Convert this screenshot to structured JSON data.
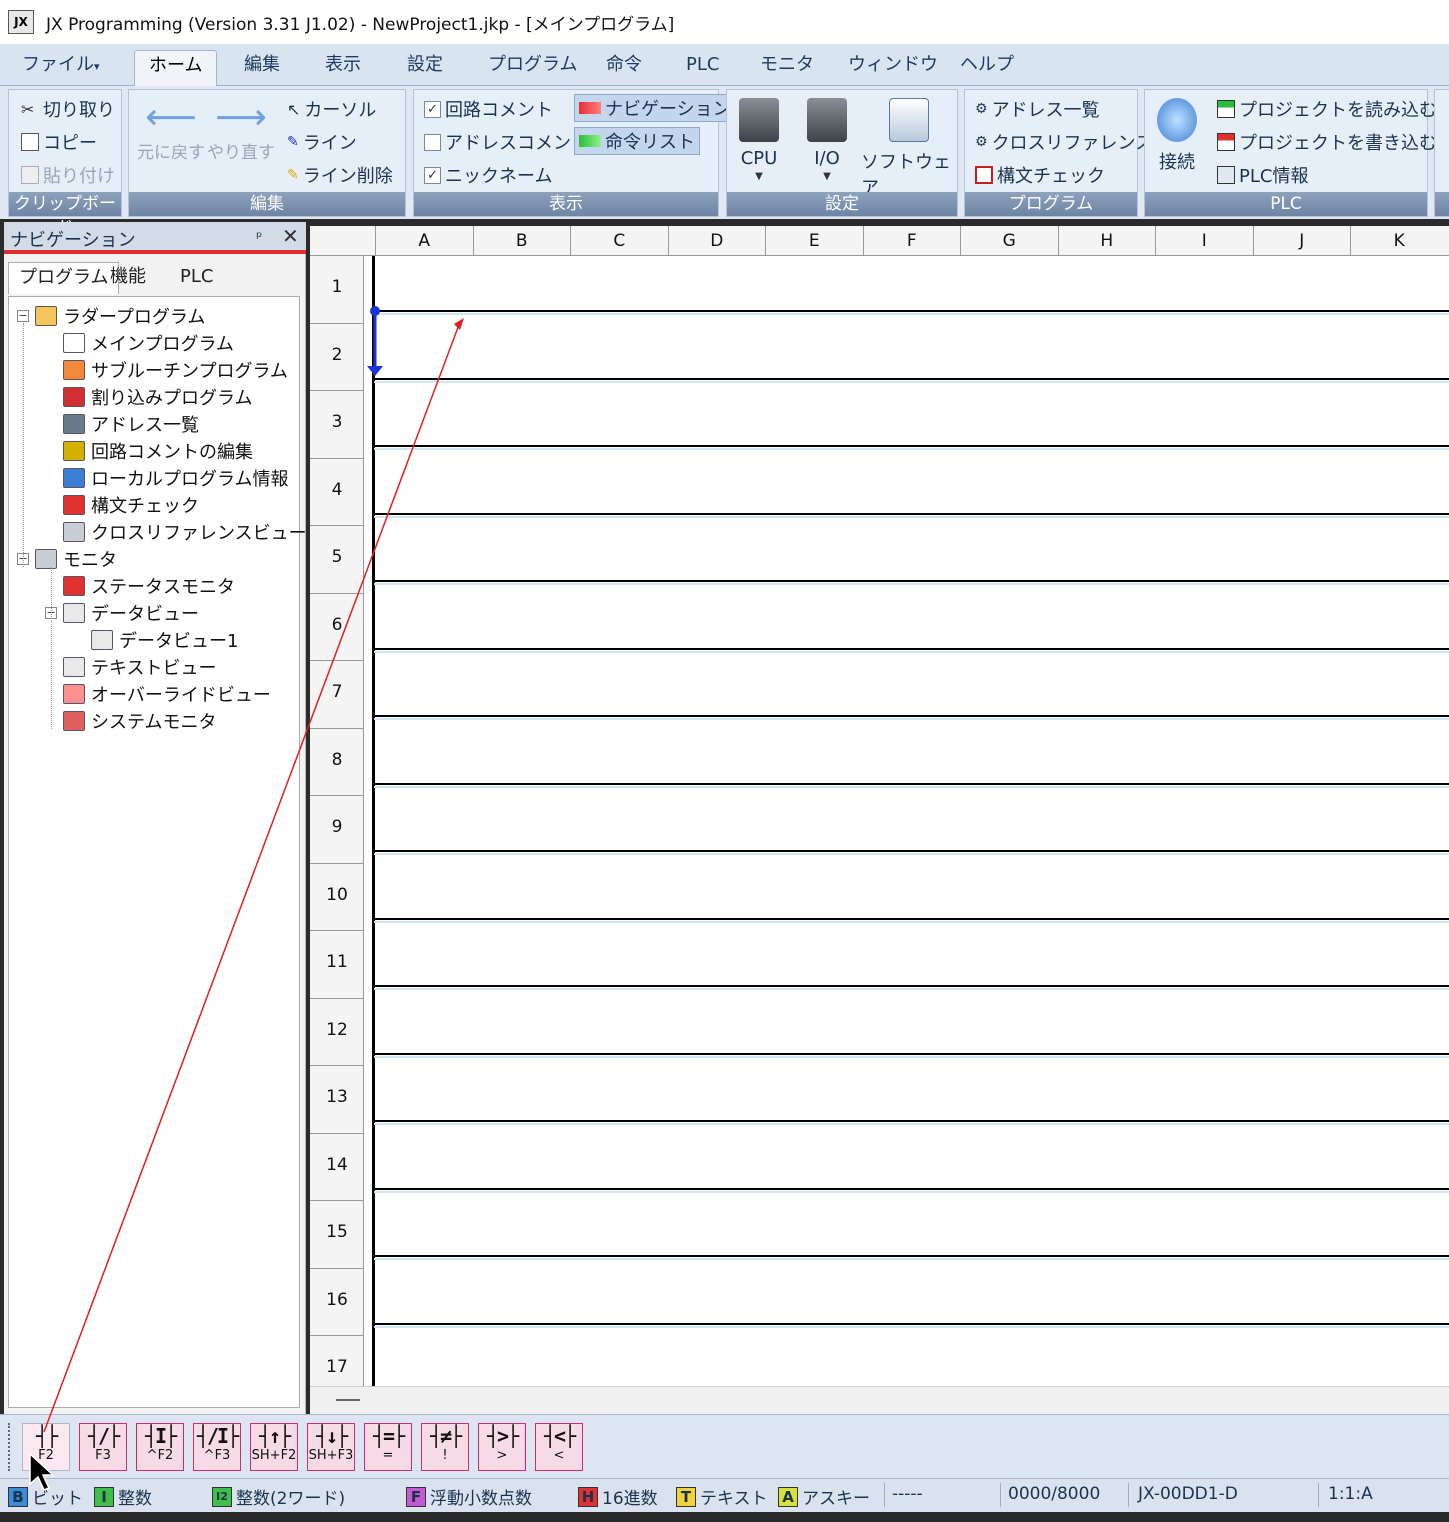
{
  "window": {
    "title": "JX Programming (Version 3.31 J1.02) - NewProject1.jkp - [メインプログラム]",
    "app_icon_text": "JX"
  },
  "menu": {
    "tabs": [
      "ファイル",
      "ホーム",
      "編集",
      "表示",
      "設定",
      "プログラム",
      "命令",
      "PLC",
      "モニタ",
      "ウィンドウ",
      "ヘルプ"
    ],
    "active": "ホーム"
  },
  "ribbon": {
    "clipboard": {
      "label": "クリップボード",
      "cut": "切り取り",
      "copy": "コピー",
      "paste": "貼り付け"
    },
    "edit": {
      "label": "編集",
      "undo": "元に戻す",
      "redo": "やり直す",
      "cursor": "カーソル",
      "line": "ライン",
      "line_delete": "ライン削除"
    },
    "view": {
      "label": "表示",
      "circuit_comment": "回路コメント",
      "circuit_comment_checked": true,
      "address_comment": "アドレスコメント",
      "address_comment_checked": false,
      "nickname": "ニックネーム",
      "nickname_checked": true,
      "navigation": "ナビゲーション",
      "instruction_list": "命令リスト"
    },
    "settings": {
      "label": "設定",
      "cpu": "CPU",
      "io": "I/O",
      "software": "ソフトウェア"
    },
    "program": {
      "label": "プログラム",
      "address_list": "アドレス一覧",
      "cross_reference": "クロスリファレンス",
      "syntax_check": "構文チェック"
    },
    "plc": {
      "label": "PLC",
      "connect": "接続",
      "read_project": "プロジェクトを読み込む",
      "write_project": "プロジェクトを書き込む",
      "plc_info": "PLC情報"
    }
  },
  "navigation": {
    "title": "ナビゲーション",
    "pin": "ᵖ",
    "close": "✕",
    "tabs": [
      "プログラム",
      "機能",
      "PLC"
    ],
    "active_tab": "プログラム",
    "tree": [
      {
        "label": "ラダープログラム",
        "level": 0,
        "expander": "−",
        "icon": "folder-open-icon"
      },
      {
        "label": "メインプログラム",
        "level": 1,
        "icon": "main-program-icon"
      },
      {
        "label": "サブルーチンプログラム",
        "level": 1,
        "icon": "subroutine-icon"
      },
      {
        "label": "割り込みプログラム",
        "level": 1,
        "icon": "interrupt-icon"
      },
      {
        "label": "アドレス一覧",
        "level": 1,
        "icon": "address-list-icon"
      },
      {
        "label": "回路コメントの編集",
        "level": 1,
        "icon": "comment-edit-icon"
      },
      {
        "label": "ローカルプログラム情報",
        "level": 1,
        "icon": "local-info-icon"
      },
      {
        "label": "構文チェック",
        "level": 1,
        "icon": "syntax-check-icon"
      },
      {
        "label": "クロスリファレンスビュー",
        "level": 1,
        "icon": "cross-ref-icon"
      },
      {
        "label": "モニタ",
        "level": 0,
        "expander": "−",
        "icon": "monitor-icon"
      },
      {
        "label": "ステータスモニタ",
        "level": 1,
        "icon": "status-monitor-icon"
      },
      {
        "label": "データビュー",
        "level": 1,
        "expander": "−",
        "icon": "data-view-icon"
      },
      {
        "label": "データビュー1",
        "level": 2,
        "icon": "data-view-icon"
      },
      {
        "label": "テキストビュー",
        "level": 1,
        "icon": "text-view-icon"
      },
      {
        "label": "オーバーライドビュー",
        "level": 1,
        "icon": "override-view-icon"
      },
      {
        "label": "システムモニタ",
        "level": 1,
        "icon": "system-monitor-icon"
      }
    ]
  },
  "ladder": {
    "columns": [
      "A",
      "B",
      "C",
      "D",
      "E",
      "F",
      "G",
      "H",
      "I",
      "J",
      "K"
    ],
    "rows": [
      "1",
      "2",
      "3",
      "4",
      "5",
      "6",
      "7",
      "8",
      "9",
      "10",
      "11",
      "12",
      "13",
      "14",
      "15",
      "16",
      "17"
    ]
  },
  "instruction_toolbar": [
    {
      "symbol": "┤├",
      "key": "F2",
      "name": "contact-no"
    },
    {
      "symbol": "┤/├",
      "key": "F3",
      "name": "contact-nc"
    },
    {
      "symbol": "┤I├",
      "key": "^F2",
      "name": "contact-direct-no"
    },
    {
      "symbol": "┤/I├",
      "key": "^F3",
      "name": "contact-direct-nc"
    },
    {
      "symbol": "┤↑├",
      "key": "SH+F2",
      "name": "contact-rising"
    },
    {
      "symbol": "┤↓├",
      "key": "SH+F3",
      "name": "contact-falling"
    },
    {
      "symbol": "┤=├",
      "key": "=",
      "name": "compare-equal"
    },
    {
      "symbol": "┤≠├",
      "key": "!",
      "name": "compare-not-equal"
    },
    {
      "symbol": "┤>├",
      "key": ">",
      "name": "compare-greater"
    },
    {
      "symbol": "┤<├",
      "key": "<",
      "name": "compare-less"
    }
  ],
  "statusbar": {
    "bit_box": "B",
    "bit": "ビット",
    "int_box": "I",
    "int": "整数",
    "int2_box": "I2",
    "int2": "整数(2ワード)",
    "float_box": "F",
    "float": "浮動小数点数",
    "hex_box": "H",
    "hex": "16進数",
    "text_box": "T",
    "text": "テキスト",
    "ascii_box": "A",
    "ascii": "アスキー",
    "dashes": "-----",
    "counter": "0000/8000",
    "model": "JX-00DD1-D",
    "position": "1:1:A"
  },
  "colors": {
    "accent_red": "#e0302f",
    "rail_blue": "#1a33d9",
    "annotation_line": "#e02020"
  }
}
